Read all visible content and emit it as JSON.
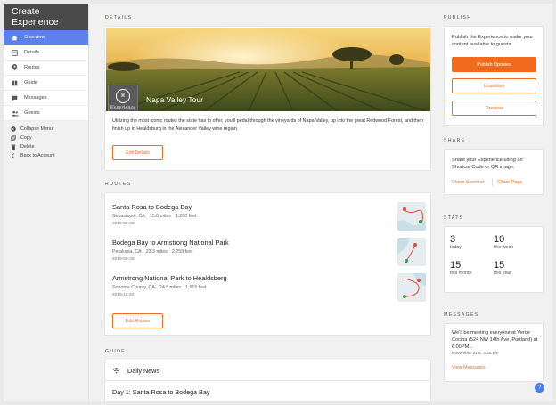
{
  "sidebar": {
    "title": "Create Experience",
    "items": [
      {
        "label": "Overview",
        "icon": "home-icon"
      },
      {
        "label": "Details",
        "icon": "details-icon"
      },
      {
        "label": "Routes",
        "icon": "pin-icon"
      },
      {
        "label": "Guide",
        "icon": "book-icon"
      },
      {
        "label": "Messages",
        "icon": "chat-icon"
      },
      {
        "label": "Guests",
        "icon": "guests-icon"
      }
    ],
    "sub_items": [
      {
        "label": "Collapse Menu",
        "icon": "collapse-icon"
      },
      {
        "label": "Copy",
        "icon": "copy-icon"
      },
      {
        "label": "Delete",
        "icon": "trash-icon"
      },
      {
        "label": "Back to Account",
        "icon": "chevron-left-icon"
      }
    ]
  },
  "details": {
    "section_label": "DETAILS",
    "logo_text": "Experience",
    "title": "Napa Valley Tour",
    "description": "Utilizing the most iconic routes the state has to offer, you'll pedal through the vineyards of Napa Valley, up into the great Redwood Forest, and then finish up in Healdsburg in the Alexander Valley wine region.",
    "edit_label": "Edit Details"
  },
  "routes": {
    "section_label": "ROUTES",
    "items": [
      {
        "title": "Santa Rosa to Bodega Bay",
        "location": "Sebastopol, CA",
        "distance": "15.8 miles",
        "elevation": "1,280 feet",
        "date": "2019-09-29"
      },
      {
        "title": "Bodega Bay to Armstrong National Park",
        "location": "Petaluma, CA",
        "distance": "23.3 miles",
        "elevation": "2,259 feet",
        "date": "2019-09-29"
      },
      {
        "title": "Armstrong National Park to Healdsberg",
        "location": "Sonoma County, CA",
        "distance": "24.8 miles",
        "elevation": "1,915 feet",
        "date": "2019-11-20"
      }
    ],
    "edit_label": "Edit Routes"
  },
  "guide": {
    "section_label": "GUIDE",
    "rows": [
      "Daily News",
      "Day 1: Santa Rosa to Bodega Bay"
    ]
  },
  "publish": {
    "section_label": "PUBLISH",
    "text": "Publish the Experience to make your content available to guests.",
    "publish_label": "Publish Updates",
    "unpublish_label": "Unpublish",
    "preview_label": "Preview"
  },
  "share": {
    "section_label": "SHARE",
    "text": "Share your Experience using an Shortcut Code or QR image.",
    "shortcut_label": "Share Shortcut",
    "page_label": "Share Page"
  },
  "stats": {
    "section_label": "STATS",
    "items": [
      {
        "value": "3",
        "label": "today"
      },
      {
        "value": "10",
        "label": "this week"
      },
      {
        "value": "15",
        "label": "this month"
      },
      {
        "value": "15",
        "label": "this year"
      }
    ]
  },
  "messages": {
    "section_label": "MESSAGES",
    "text": "We'll be meeting everyone at Verde Cocina (524 NW 14th Ave, Portland) at 6:00PM...",
    "date": "November 21st, 4:25 pm",
    "link_label": "View Messages"
  },
  "help_icon": "?",
  "colors": {
    "accent": "#f26a1b",
    "nav_active": "#5b82ec",
    "sidebar_header": "#4a4a4a",
    "help": "#4d7be8"
  }
}
